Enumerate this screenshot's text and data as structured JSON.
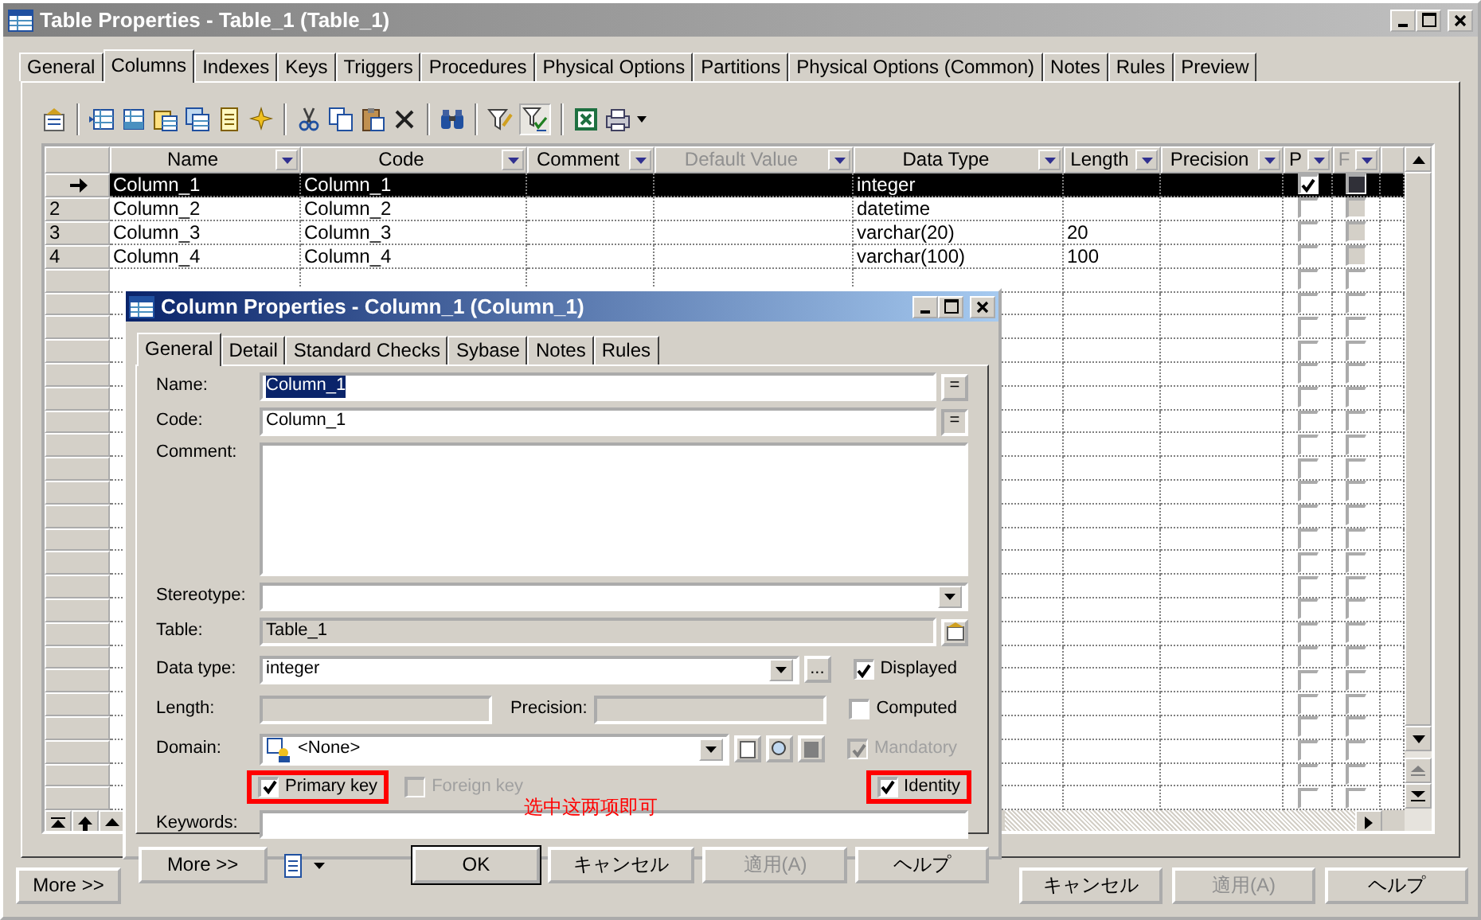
{
  "window": {
    "title": "Table Properties - Table_1 (Table_1)"
  },
  "tabs": [
    {
      "label": "General",
      "selected": false
    },
    {
      "label": "Columns",
      "selected": true
    },
    {
      "label": "Indexes",
      "selected": false
    },
    {
      "label": "Keys",
      "selected": false
    },
    {
      "label": "Triggers",
      "selected": false
    },
    {
      "label": "Procedures",
      "selected": false
    },
    {
      "label": "Physical Options",
      "selected": false
    },
    {
      "label": "Partitions",
      "selected": false
    },
    {
      "label": "Physical Options (Common)",
      "selected": false
    },
    {
      "label": "Notes",
      "selected": false
    },
    {
      "label": "Rules",
      "selected": false
    },
    {
      "label": "Preview",
      "selected": false
    }
  ],
  "toolbar": [
    [
      {
        "kind": "properties",
        "pressed": false
      }
    ],
    [
      {
        "kind": "insert_row",
        "pressed": false
      },
      {
        "kind": "add_row",
        "pressed": false
      },
      {
        "kind": "add_columns",
        "pressed": false
      },
      {
        "kind": "reuse_columns",
        "pressed": false
      },
      {
        "kind": "note",
        "pressed": false
      },
      {
        "kind": "new",
        "pressed": false
      }
    ],
    [
      {
        "kind": "cut",
        "pressed": false
      },
      {
        "kind": "copy",
        "pressed": false
      },
      {
        "kind": "paste",
        "pressed": false
      },
      {
        "kind": "delete",
        "pressed": false
      }
    ],
    [
      {
        "kind": "find",
        "pressed": false
      }
    ],
    [
      {
        "kind": "filter_edit",
        "pressed": false
      },
      {
        "kind": "filter",
        "pressed": true
      }
    ],
    [
      {
        "kind": "excel",
        "pressed": false
      },
      {
        "kind": "print",
        "pressed": false
      }
    ]
  ],
  "grid": {
    "columns": [
      {
        "label": "Name",
        "disabled": false
      },
      {
        "label": "Code",
        "disabled": false
      },
      {
        "label": "Comment",
        "disabled": false
      },
      {
        "label": "Default Value",
        "disabled": true
      },
      {
        "label": "Data Type",
        "disabled": false
      },
      {
        "label": "Length",
        "disabled": false
      },
      {
        "label": "Precision",
        "disabled": false
      },
      {
        "label": "P",
        "disabled": false
      },
      {
        "label": "F",
        "disabled": true
      }
    ],
    "rows": [
      {
        "current": true,
        "selected": true,
        "name": "Column_1",
        "code": "Column_1",
        "data_type": "integer",
        "primary": true,
        "foreign": false
      },
      {
        "number": "2",
        "current": false,
        "selected": false,
        "name": "Column_2",
        "code": "Column_2",
        "data_type": "datetime",
        "primary": false,
        "foreign": false
      },
      {
        "number": "3",
        "current": false,
        "selected": false,
        "name": "Column_3",
        "code": "Column_3",
        "data_type": "varchar(20)",
        "length": "20",
        "primary": false,
        "foreign": false
      },
      {
        "number": "4",
        "current": false,
        "selected": false,
        "name": "Column_4",
        "code": "Column_4",
        "data_type": "varchar(100)",
        "length": "100",
        "primary": false,
        "foreign": false
      },
      {
        "current": false,
        "selected": false,
        "primary": false,
        "foreign": false
      },
      {
        "current": false,
        "selected": false,
        "primary": false,
        "foreign": false
      },
      {
        "current": false,
        "selected": false,
        "primary": false,
        "foreign": false
      },
      {
        "current": false,
        "selected": false,
        "primary": false,
        "foreign": false
      },
      {
        "current": false,
        "selected": false,
        "primary": false,
        "foreign": false
      },
      {
        "current": false,
        "selected": false,
        "primary": false,
        "foreign": false
      },
      {
        "current": false,
        "selected": false,
        "primary": false,
        "foreign": false
      },
      {
        "current": false,
        "selected": false,
        "primary": false,
        "foreign": false
      },
      {
        "current": false,
        "selected": false,
        "primary": false,
        "foreign": false
      },
      {
        "current": false,
        "selected": false,
        "primary": false,
        "foreign": false
      },
      {
        "current": false,
        "selected": false,
        "primary": false,
        "foreign": false
      },
      {
        "current": false,
        "selected": false,
        "primary": false,
        "foreign": false
      },
      {
        "current": false,
        "selected": false,
        "primary": false,
        "foreign": false
      },
      {
        "current": false,
        "selected": false,
        "primary": false,
        "foreign": false
      },
      {
        "current": false,
        "selected": false,
        "primary": false,
        "foreign": false
      },
      {
        "current": false,
        "selected": false,
        "primary": false,
        "foreign": false
      },
      {
        "current": false,
        "selected": false,
        "primary": false,
        "foreign": false
      },
      {
        "current": false,
        "selected": false,
        "primary": false,
        "foreign": false
      },
      {
        "current": false,
        "selected": false,
        "primary": false,
        "foreign": false
      },
      {
        "current": false,
        "selected": false,
        "primary": false,
        "foreign": false
      },
      {
        "current": false,
        "selected": false,
        "primary": false,
        "foreign": false
      },
      {
        "current": false,
        "selected": false,
        "primary": false,
        "foreign": false
      },
      {
        "current": false,
        "selected": false,
        "primary": false,
        "foreign": false
      }
    ]
  },
  "buttons": [
    {
      "label": "More >>",
      "disabled": false
    },
    {
      "label": "キャンセル",
      "disabled": false
    },
    {
      "label": "適用(A)",
      "disabled": true
    },
    {
      "label": "ヘルプ",
      "disabled": false
    }
  ],
  "dialog": {
    "title": "Column Properties - Column_1 (Column_1)",
    "tabs": [
      {
        "label": "General",
        "selected": true
      },
      {
        "label": "Detail",
        "selected": false
      },
      {
        "label": "Standard Checks",
        "selected": false
      },
      {
        "label": "Sybase",
        "selected": false
      },
      {
        "label": "Notes",
        "selected": false
      },
      {
        "label": "Rules",
        "selected": false
      }
    ],
    "name": {
      "label": "Name:",
      "value": "Column_1",
      "text_selected": true,
      "button": "="
    },
    "code": {
      "label": "Code:",
      "value": "Column_1",
      "button": "="
    },
    "comment": {
      "label": "Comment:"
    },
    "stereotype": {
      "label": "Stereotype:"
    },
    "table": {
      "label": "Table:",
      "value": "Table_1"
    },
    "data_type": {
      "label": "Data type:",
      "value": "integer",
      "button": "..."
    },
    "length": {
      "label": "Length:"
    },
    "precision": {
      "label": "Precision:"
    },
    "domain": {
      "label": "Domain:",
      "value": "<None>"
    },
    "keywords": {
      "label": "Keywords:"
    },
    "checkboxes": [
      {
        "label": "Displayed",
        "checked": true,
        "disabled": false,
        "highlighted": false
      },
      {
        "label": "Computed",
        "checked": false,
        "disabled": false,
        "highlighted": false
      },
      {
        "label": "Mandatory",
        "checked": true,
        "disabled": true,
        "highlighted": false
      },
      {
        "label": "Primary key",
        "checked": true,
        "disabled": false,
        "highlighted": true
      },
      {
        "label": "Foreign key",
        "checked": false,
        "disabled": true,
        "highlighted": false
      },
      {
        "label": "Identity",
        "checked": true,
        "disabled": false,
        "highlighted": true
      }
    ],
    "annotation": "选中这两项即可",
    "buttons": [
      {
        "label": "More >>",
        "disabled": false,
        "default": false
      },
      {
        "label": "OK",
        "disabled": false,
        "default": true
      },
      {
        "label": "キャンセル",
        "disabled": false,
        "default": false
      },
      {
        "label": "適用(A)",
        "disabled": true,
        "default": false
      },
      {
        "label": "ヘルプ",
        "disabled": false,
        "default": false
      }
    ]
  }
}
